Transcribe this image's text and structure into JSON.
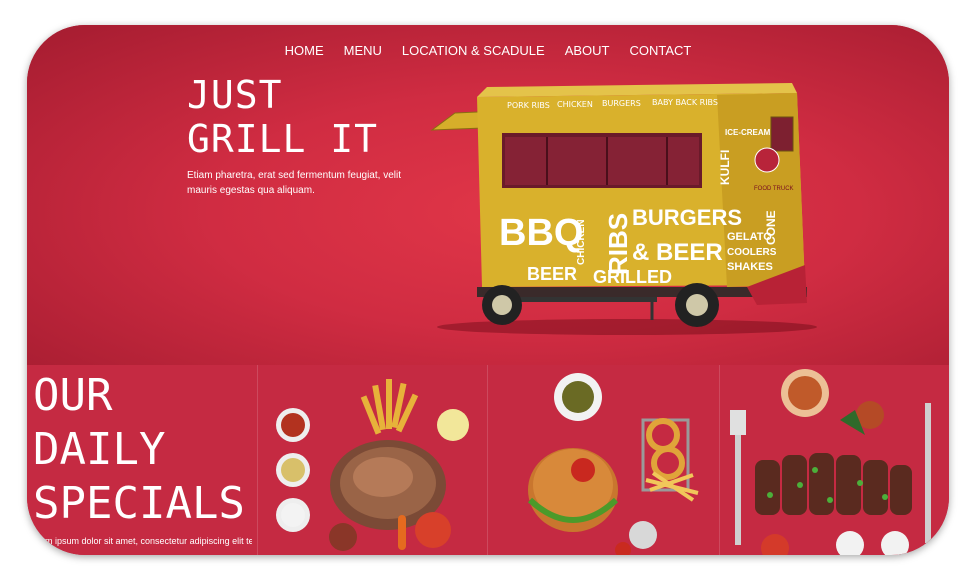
{
  "nav": {
    "items": [
      "HOME",
      "MENU",
      "LOCATION & SCADULE",
      "ABOUT",
      "CONTACT"
    ]
  },
  "hero": {
    "title_line1": "JUST",
    "title_line2": "GRILL IT",
    "text": "Etiam pharetra, erat sed fermentum feugiat, velit mauris egestas qua aliquam."
  },
  "truck": {
    "roof_labels": [
      "PORK RIBS",
      "CHICKEN",
      "BURGERS",
      "BABY BACK RIBS"
    ],
    "side_words": [
      "BBQ",
      "CHICKEN",
      "RIBS",
      "BURGERS",
      "& BEER",
      "BEER",
      "GRILLED"
    ],
    "rear_words": [
      "ICE-CREAM",
      "KULFI",
      "GELATO",
      "COOLERS",
      "SHAKES",
      "CONE"
    ],
    "badge": "FOOD TRUCK"
  },
  "specials": {
    "title_line1": "OUR",
    "title_line2": "DAILY",
    "title_line3": "SPECIALS",
    "text": "Lorem ipsum dolor sit amet, consectetur adipiscing elit tellus, luctus nec ullamcorper"
  },
  "colors": {
    "brand_red": "#c42740",
    "truck_yellow": "#d9b12c"
  }
}
